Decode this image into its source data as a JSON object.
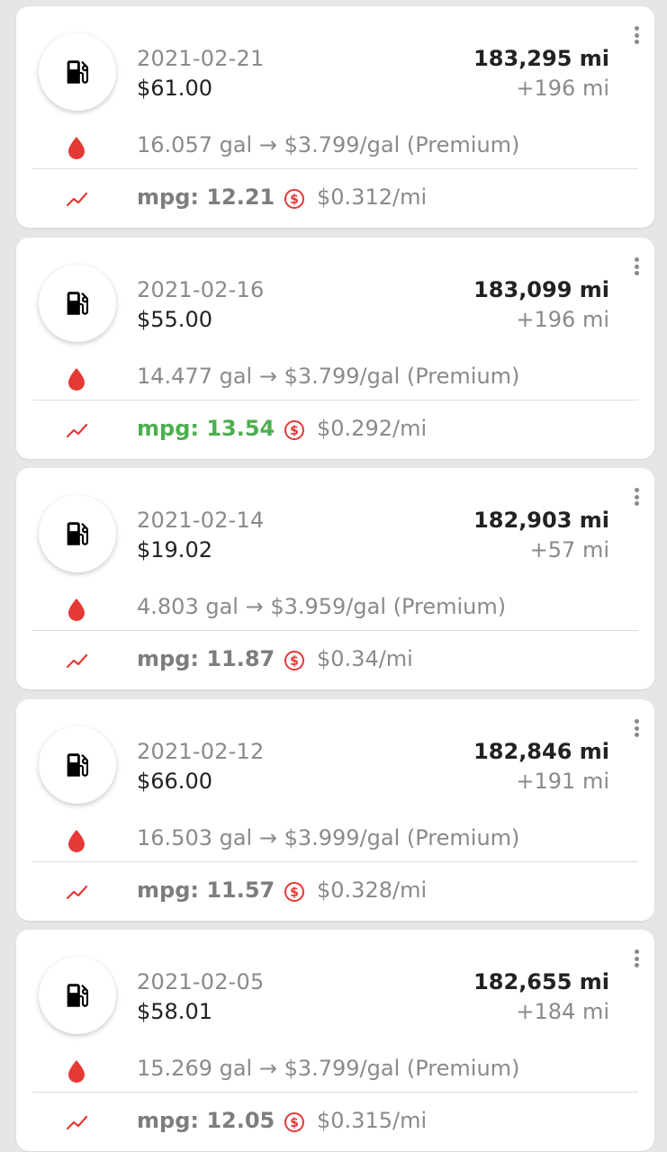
{
  "colors": {
    "accent_red": "#e53935",
    "best_green": "#4caf50",
    "muted_text": "#8a8a8a"
  },
  "icons": {
    "entry": "fuel-pump-icon",
    "fuel": "drop-icon",
    "trend": "trending-up-icon",
    "cost_per_mile": "dollar-circle-icon",
    "menu": "more-vert-icon"
  },
  "entries": [
    {
      "date": "2021-02-21",
      "total_cost": "$61.00",
      "odometer": "183,295 mi",
      "distance": "+196 mi",
      "fuel_summary": "16.057 gal → $3.799/gal (Premium)",
      "mpg": "mpg: 12.21",
      "cost_per_mile": "$0.312/mi"
    },
    {
      "date": "2021-02-16",
      "total_cost": "$55.00",
      "odometer": "183,099 mi",
      "distance": "+196 mi",
      "fuel_summary": "14.477 gal → $3.799/gal (Premium)",
      "mpg": "mpg: 13.54",
      "cost_per_mile": "$0.292/mi"
    },
    {
      "date": "2021-02-14",
      "total_cost": "$19.02",
      "odometer": "182,903 mi",
      "distance": "+57 mi",
      "fuel_summary": "4.803 gal → $3.959/gal (Premium)",
      "mpg": "mpg: 11.87",
      "cost_per_mile": "$0.34/mi"
    },
    {
      "date": "2021-02-12",
      "total_cost": "$66.00",
      "odometer": "182,846 mi",
      "distance": "+191 mi",
      "fuel_summary": "16.503 gal → $3.999/gal (Premium)",
      "mpg": "mpg: 11.57",
      "cost_per_mile": "$0.328/mi"
    },
    {
      "date": "2021-02-05",
      "total_cost": "$58.01",
      "odometer": "182,655 mi",
      "distance": "+184 mi",
      "fuel_summary": "15.269 gal → $3.799/gal (Premium)",
      "mpg": "mpg: 12.05",
      "cost_per_mile": "$0.315/mi"
    }
  ]
}
